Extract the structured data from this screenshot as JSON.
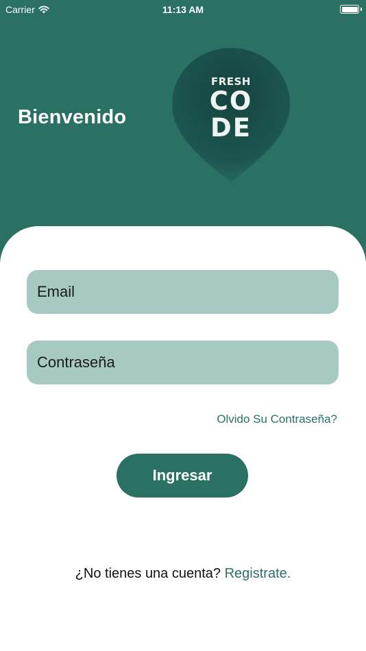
{
  "status_bar": {
    "carrier": "Carrier",
    "time": "11:13 AM",
    "wifi_icon": "wifi-icon",
    "battery_icon": "battery-full-icon"
  },
  "header": {
    "welcome_text": "Bienvenido",
    "logo": {
      "line1": "FRESH",
      "line2": "CO",
      "line3": "DE"
    }
  },
  "form": {
    "email_placeholder": "Email",
    "password_placeholder": "Contraseña",
    "forgot_password": "Olvido Su Contraseña?",
    "login_button": "Ingresar",
    "signup_prompt": "¿No tienes una cuenta?",
    "signup_link": "Registrate."
  },
  "colors": {
    "primary": "#2a7063",
    "field_background": "#a6c9c1",
    "card_background": "#ffffff"
  }
}
